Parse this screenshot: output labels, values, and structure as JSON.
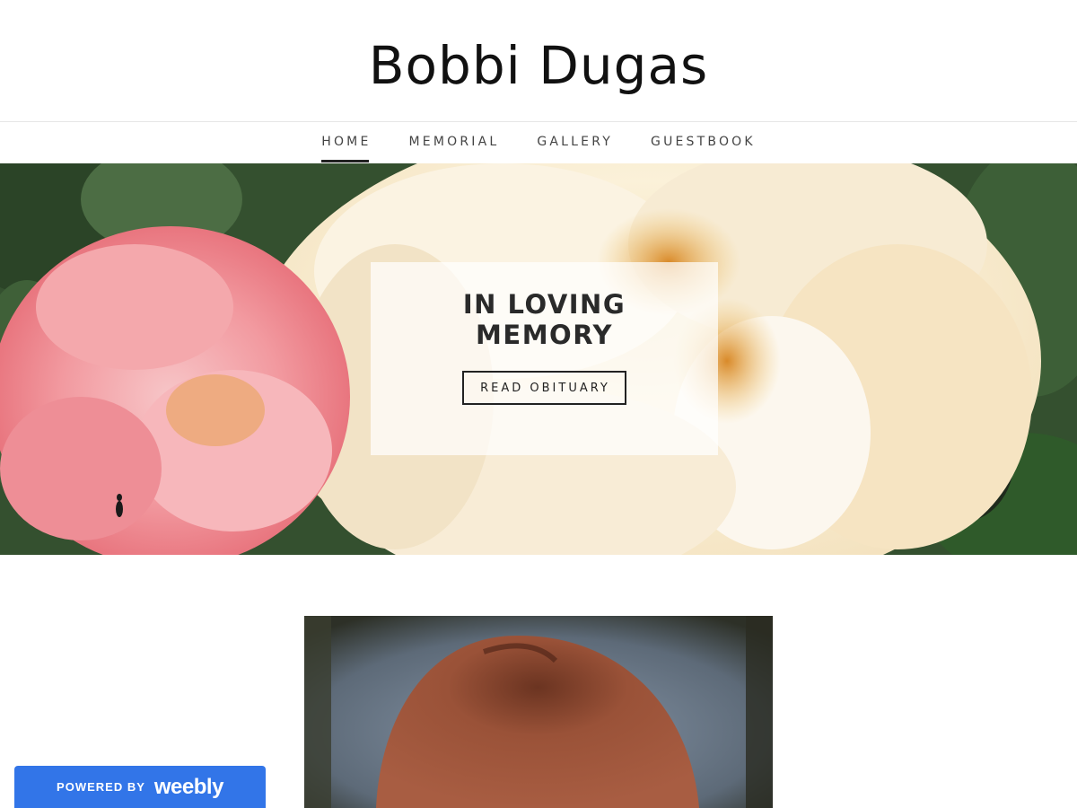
{
  "site": {
    "title": "Bobbi Dugas"
  },
  "nav": {
    "items": [
      {
        "label": "HOME",
        "active": true
      },
      {
        "label": "MEMORIAL",
        "active": false
      },
      {
        "label": "GALLERY",
        "active": false
      },
      {
        "label": "GUESTBOOK",
        "active": false
      }
    ]
  },
  "hero": {
    "heading": "IN LOVING MEMORY",
    "button_label": "READ OBITUARY",
    "image": "peony-flowers-image"
  },
  "photo": {
    "image": "portrait-photo"
  },
  "badge": {
    "prefix": "POWERED BY",
    "brand": "weebly"
  },
  "colors": {
    "badge_blue": "#3275e8",
    "text_dark": "#222222",
    "nav_text": "#444444"
  }
}
